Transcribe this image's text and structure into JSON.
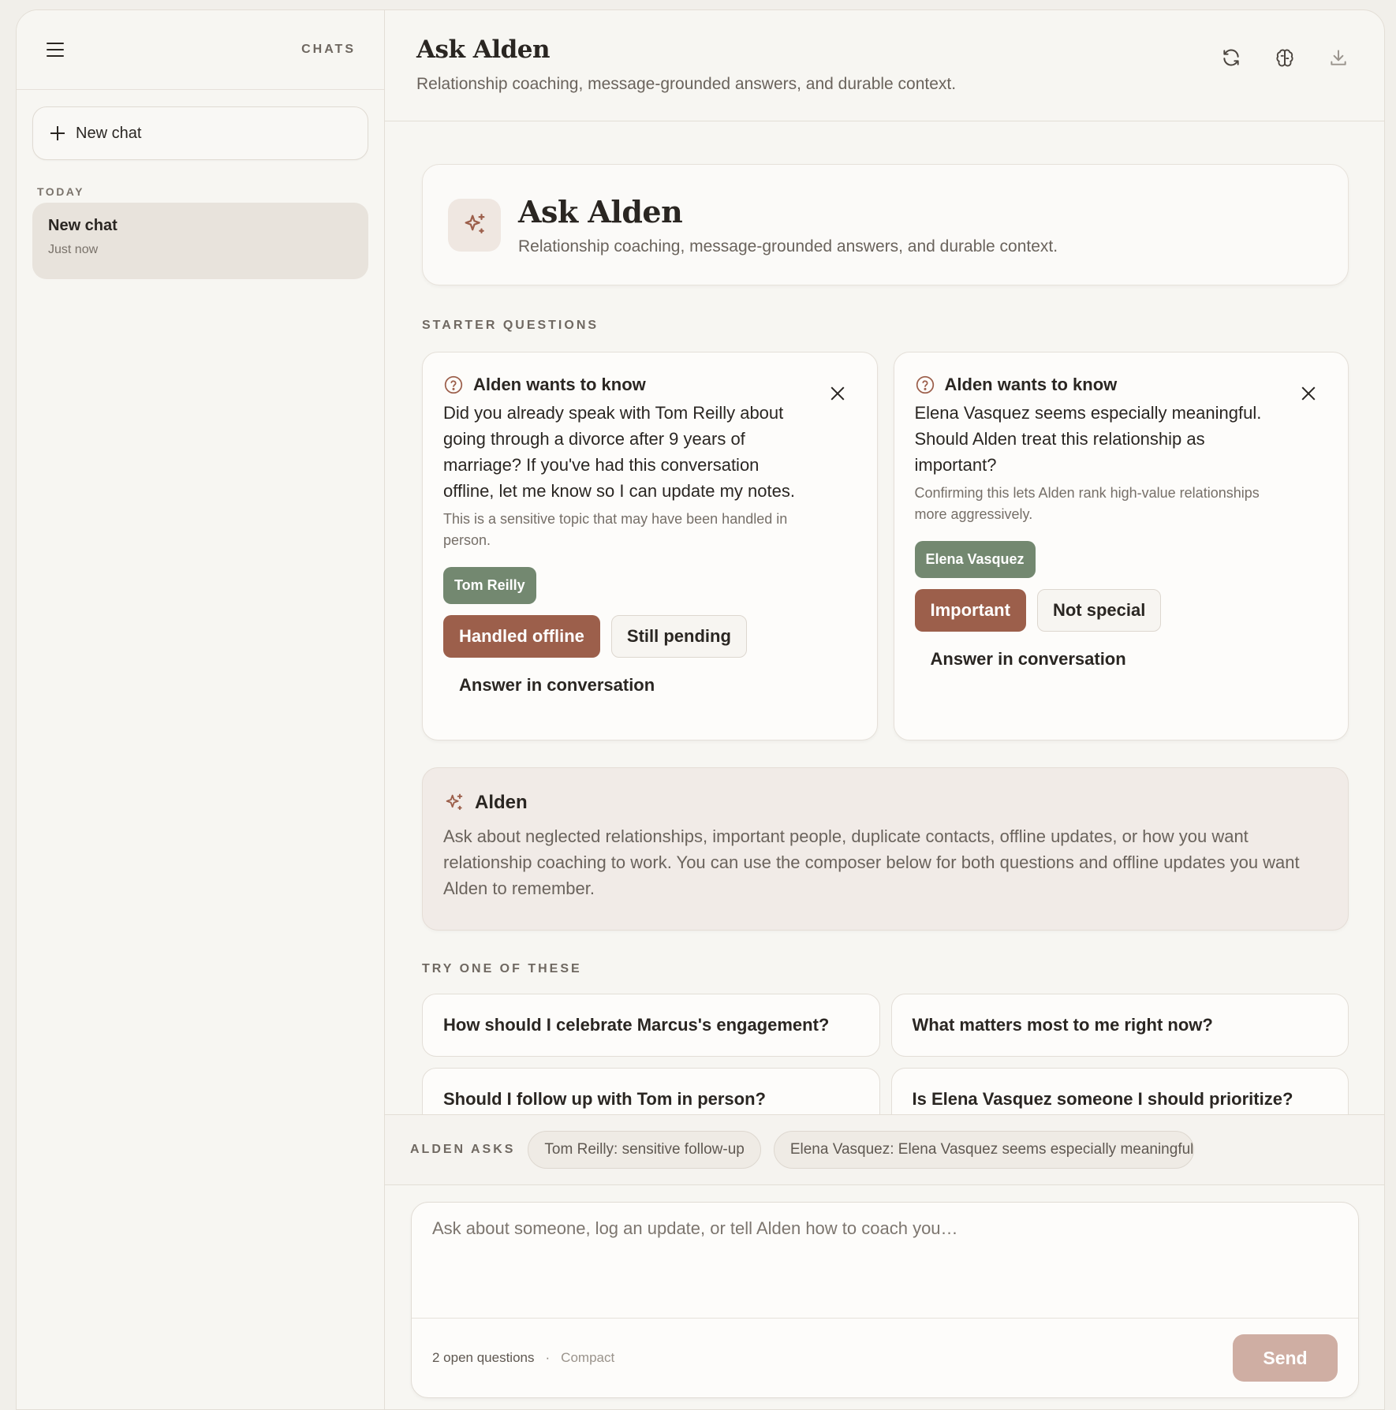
{
  "sidebar": {
    "title": "CHATS",
    "new_chat_label": "New chat",
    "section_today": "TODAY",
    "items": [
      {
        "title": "New chat",
        "subtitle": "Just now"
      }
    ]
  },
  "header": {
    "title": "Ask Alden",
    "subtitle": "Relationship coaching, message-grounded answers, and durable context.",
    "icons": [
      "refresh-icon",
      "brain-icon",
      "download-icon"
    ]
  },
  "hero": {
    "title": "Ask Alden",
    "subtitle": "Relationship coaching, message-grounded answers, and durable context.",
    "icon": "sparkle-icon"
  },
  "starter": {
    "label": "STARTER QUESTIONS",
    "cards": [
      {
        "heading": "Alden wants to know",
        "question": "Did you already speak with Tom Reilly about going through a divorce after 9 years of marriage? If you've had this conversation offline, let me know so I can update my notes.",
        "note": "This is a sensitive topic that may have been handled in person.",
        "person": "Tom Reilly",
        "primary": "Handled offline",
        "secondary": "Still pending",
        "text_action": "Answer in conversation"
      },
      {
        "heading": "Alden wants to know",
        "question": "Elena Vasquez seems especially meaningful. Should Alden treat this relationship as important?",
        "note": "Confirming this lets Alden rank high-value relationships more aggressively.",
        "person": "Elena Vasquez",
        "primary": "Important",
        "secondary": "Not special",
        "text_action": "Answer in conversation"
      }
    ]
  },
  "alden_message": {
    "name": "Alden",
    "body": "Ask about neglected relationships, important people, duplicate contacts, offline updates, or how you want relationship coaching to work. You can use the composer below for both questions and offline updates you want Alden to remember."
  },
  "try": {
    "label": "TRY ONE OF THESE",
    "items": [
      "How should I celebrate Marcus's engagement?",
      "What matters most to me right now?",
      "Should I follow up with Tom in person?",
      "Is Elena Vasquez someone I should prioritize?"
    ]
  },
  "asks": {
    "label": "ALDEN ASKS",
    "pills": [
      "Tom Reilly: sensitive follow-up",
      "Elena Vasquez: Elena Vasquez seems especially meaningful. S"
    ]
  },
  "composer": {
    "placeholder": "Ask about someone, log an update, or tell Alden how to coach you…",
    "open_questions": "2 open questions",
    "separator": "·",
    "compact": "Compact",
    "send": "Send"
  },
  "colors": {
    "accent": "#9c5f4b",
    "person_chip": "#738870",
    "send_disabled": "#cfaea3"
  }
}
